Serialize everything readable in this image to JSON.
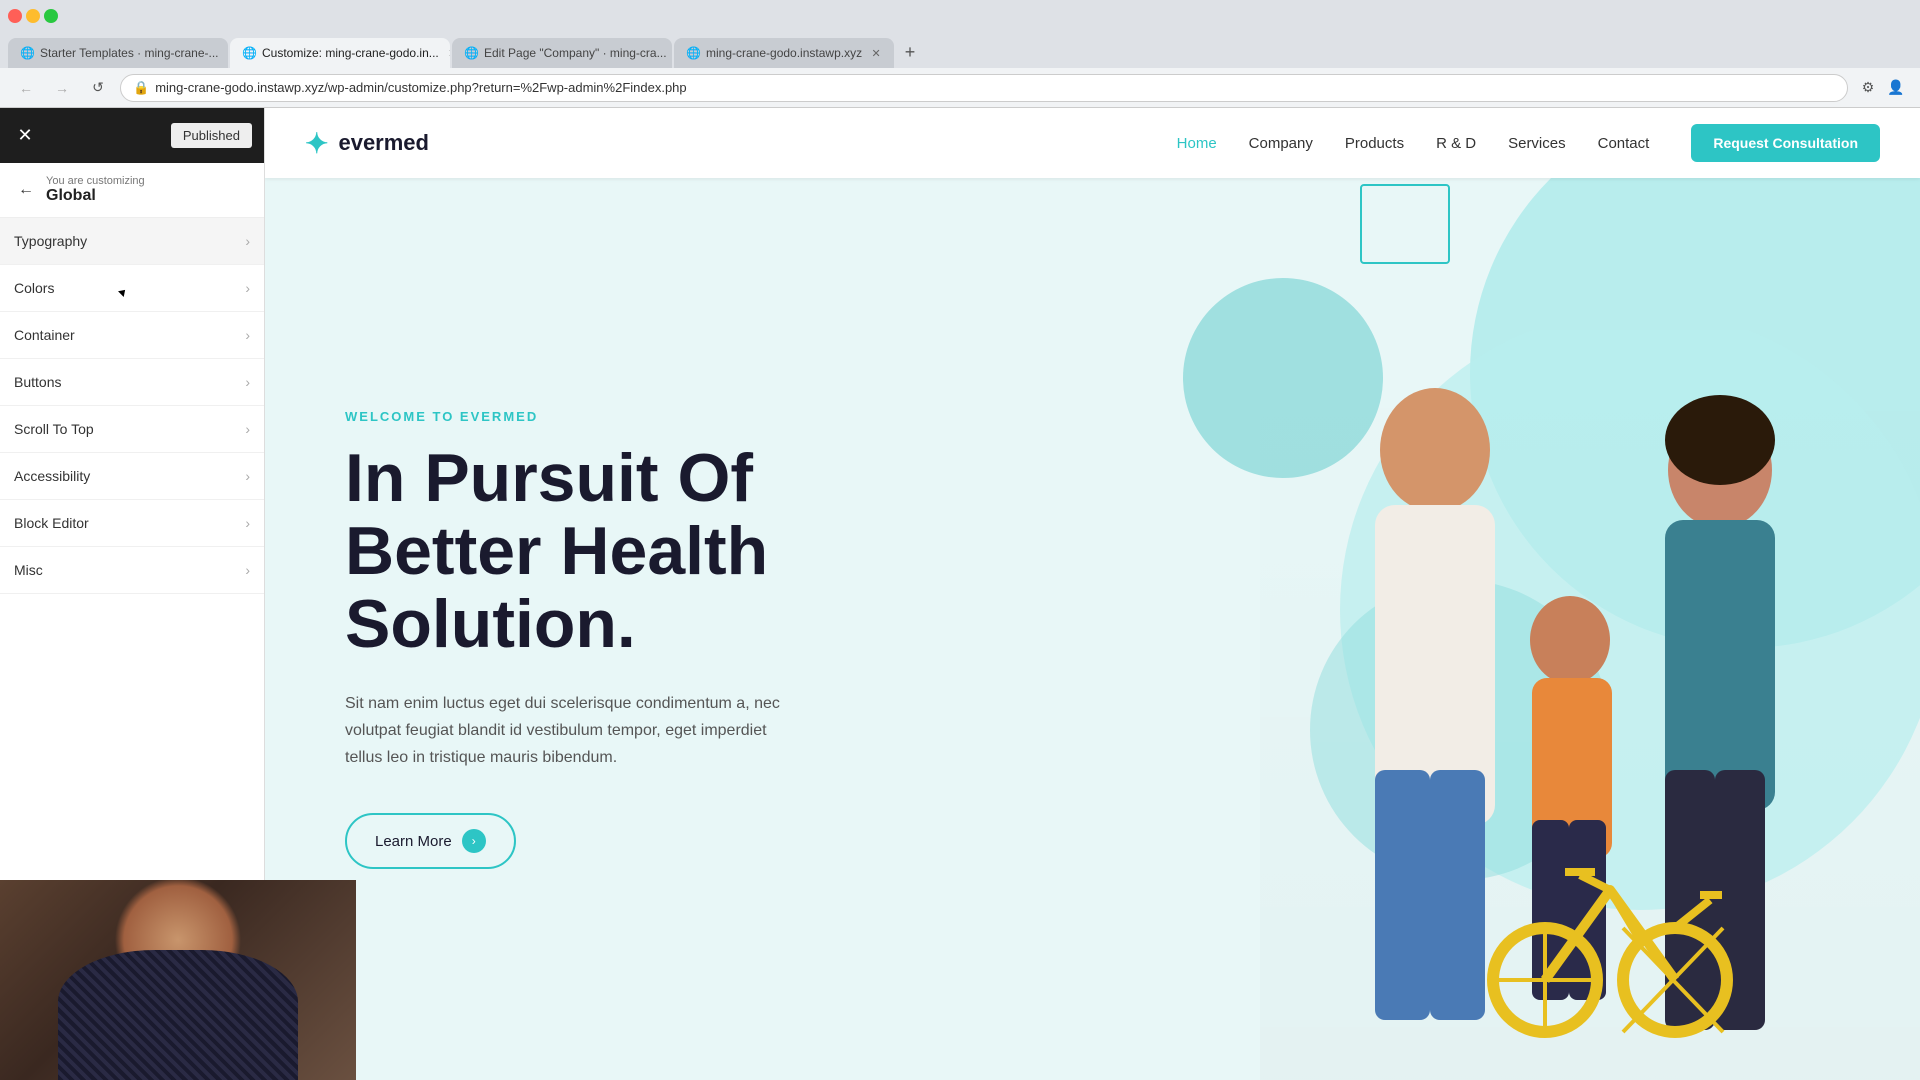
{
  "browser": {
    "tabs": [
      {
        "id": "tab1",
        "favicon": "🌐",
        "label": "Starter Templates · ming-crane-...",
        "active": false
      },
      {
        "id": "tab2",
        "favicon": "🌐",
        "label": "Customize: ming-crane-godo.in...",
        "active": true
      },
      {
        "id": "tab3",
        "favicon": "🌐",
        "label": "Edit Page \"Company\" · ming-cra...",
        "active": false
      },
      {
        "id": "tab4",
        "favicon": "🌐",
        "label": "ming-crane-godo.instawp.xyz",
        "active": false
      }
    ],
    "url": "ming-crane-godo.instawp.xyz/wp-admin/customize.php?return=%2Fwp-admin%2Findex.php",
    "back_disabled": false,
    "forward_disabled": false
  },
  "customizer": {
    "header": {
      "close_label": "✕",
      "published_label": "Published"
    },
    "breadcrumb": {
      "you_are_customizing": "You are customizing",
      "section": "Global"
    },
    "menu_items": [
      {
        "id": "typography",
        "label": "Typography",
        "has_arrow": true
      },
      {
        "id": "colors",
        "label": "Colors",
        "has_arrow": true
      },
      {
        "id": "container",
        "label": "Container",
        "has_arrow": true
      },
      {
        "id": "buttons",
        "label": "Buttons",
        "has_arrow": true
      },
      {
        "id": "scroll-to-top",
        "label": "Scroll To Top",
        "has_arrow": true
      },
      {
        "id": "accessibility",
        "label": "Accessibility",
        "has_arrow": true
      },
      {
        "id": "block-editor",
        "label": "Block Editor",
        "has_arrow": true
      },
      {
        "id": "misc",
        "label": "Misc",
        "has_arrow": true
      }
    ]
  },
  "site": {
    "logo_text": "evermed",
    "logo_icon": "✦",
    "nav": {
      "items": [
        {
          "label": "Home",
          "active": true
        },
        {
          "label": "Company",
          "active": false
        },
        {
          "label": "Products",
          "active": false
        },
        {
          "label": "R & D",
          "active": false
        },
        {
          "label": "Services",
          "active": false
        },
        {
          "label": "Contact",
          "active": false
        }
      ],
      "cta_label": "Request Consultation"
    },
    "hero": {
      "eyebrow": "WELCOME TO EVERMED",
      "title_line1": "In Pursuit Of",
      "title_line2": "Better Health",
      "title_line3": "Solution.",
      "description": "Sit nam enim luctus eget dui scelerisque condimentum a, nec volutpat feugiat blandit id vestibulum tempor, eget imperdiet tellus leo in tristique mauris bibendum.",
      "cta_label": "Learn More",
      "cta_arrow": "›"
    }
  }
}
